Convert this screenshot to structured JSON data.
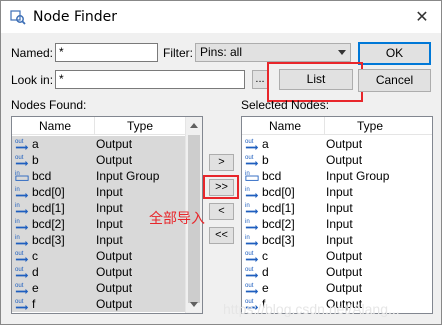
{
  "window": {
    "title": "Node Finder",
    "close_glyph": "✕"
  },
  "form": {
    "named_label": "Named:",
    "named_value": "*",
    "filter_label": "Filter:",
    "filter_value": "Pins: all",
    "lookin_label": "Look in:",
    "lookin_value": "*",
    "browse_label": "...",
    "ok_label": "OK",
    "list_label": "List",
    "cancel_label": "Cancel"
  },
  "found": {
    "section_label": "Nodes Found:",
    "col_name": "Name",
    "col_type": "Type",
    "rows": [
      {
        "icon": "output-pin-icon",
        "name": "a",
        "type": "Output"
      },
      {
        "icon": "output-pin-icon",
        "name": "b",
        "type": "Output"
      },
      {
        "icon": "input-group-icon",
        "name": "bcd",
        "type": "Input Group"
      },
      {
        "icon": "input-pin-icon",
        "name": "bcd[0]",
        "type": "Input"
      },
      {
        "icon": "input-pin-icon",
        "name": "bcd[1]",
        "type": "Input"
      },
      {
        "icon": "input-pin-icon",
        "name": "bcd[2]",
        "type": "Input"
      },
      {
        "icon": "input-pin-icon",
        "name": "bcd[3]",
        "type": "Input"
      },
      {
        "icon": "output-pin-icon",
        "name": "c",
        "type": "Output"
      },
      {
        "icon": "output-pin-icon",
        "name": "d",
        "type": "Output"
      },
      {
        "icon": "output-pin-icon",
        "name": "e",
        "type": "Output"
      },
      {
        "icon": "output-pin-icon",
        "name": "f",
        "type": "Output"
      }
    ]
  },
  "transfer": {
    "add_one": ">",
    "add_all": ">>",
    "remove_one": "<",
    "remove_all": "<<"
  },
  "selected": {
    "section_label": "Selected Nodes:",
    "col_name": "Name",
    "col_type": "Type",
    "rows": [
      {
        "icon": "output-pin-icon",
        "name": "a",
        "type": "Output"
      },
      {
        "icon": "output-pin-icon",
        "name": "b",
        "type": "Output"
      },
      {
        "icon": "input-group-icon",
        "name": "bcd",
        "type": "Input Group"
      },
      {
        "icon": "input-pin-icon",
        "name": "bcd[0]",
        "type": "Input"
      },
      {
        "icon": "input-pin-icon",
        "name": "bcd[1]",
        "type": "Input"
      },
      {
        "icon": "input-pin-icon",
        "name": "bcd[2]",
        "type": "Input"
      },
      {
        "icon": "input-pin-icon",
        "name": "bcd[3]",
        "type": "Input"
      },
      {
        "icon": "output-pin-icon",
        "name": "c",
        "type": "Output"
      },
      {
        "icon": "output-pin-icon",
        "name": "d",
        "type": "Output"
      },
      {
        "icon": "output-pin-icon",
        "name": "e",
        "type": "Output"
      },
      {
        "icon": "output-pin-icon",
        "name": "f",
        "type": "Output"
      }
    ]
  },
  "annotation": {
    "text": "全部导入",
    "color": "#e8262b"
  },
  "watermark": {
    "text": "https://blog.csdn.net/Alang..."
  },
  "colors": {
    "highlight": "#e8262b",
    "selection": "#d9d9d9",
    "pin_blue": "#1f5fbf"
  }
}
